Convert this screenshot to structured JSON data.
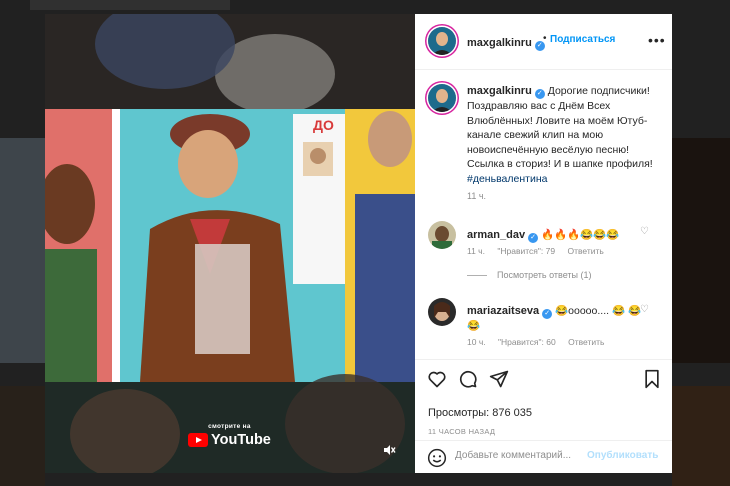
{
  "post": {
    "author": "maxgalkinru",
    "follow_label": "Подписаться",
    "more_label": "•••",
    "caption_text": "Дорогие подписчики! Поздравляю вас с Днём Всех Влюблённых! Ловите на моём Ютуб-канале свежий клип на мою новоиспечённую весёлую песню! Ссылка в сториз! И в шапке профиля! ",
    "caption_hashtag": "#деньвалентина",
    "caption_time": "11 ч.",
    "views_label": "Просмотры: 876 035",
    "time_ago": "11 ЧАСОВ НАЗАД"
  },
  "comments": [
    {
      "user": "arman_dav",
      "text": "🔥🔥🔥😂😂😂",
      "time": "11 ч.",
      "likes": "\"Нравится\": 79",
      "reply": "Ответить",
      "view_replies": "Посмотреть ответы (1)"
    },
    {
      "user": "mariazaitseva",
      "text": "😂ooooo.... 😂 😂😂",
      "time": "10 ч.",
      "likes": "\"Нравится\": 60",
      "reply": "Ответить"
    }
  ],
  "comment_form": {
    "placeholder": "Добавьте комментарий...",
    "publish_label": "Опубликовать"
  },
  "video": {
    "watch_on": "смотрите на",
    "brand": "YouTube",
    "sign_text": "ДО"
  },
  "icons": {
    "like": "heart-icon",
    "comment": "comment-icon",
    "share": "send-icon",
    "save": "bookmark-icon",
    "mute": "mute-icon",
    "emoji": "emoji-icon",
    "verified": "verified-badge-icon"
  },
  "colors": {
    "accent_blue": "#0095f6",
    "verified_blue": "#3897f0",
    "hashtag": "#00376b",
    "muted_text": "#8e8e8e"
  }
}
